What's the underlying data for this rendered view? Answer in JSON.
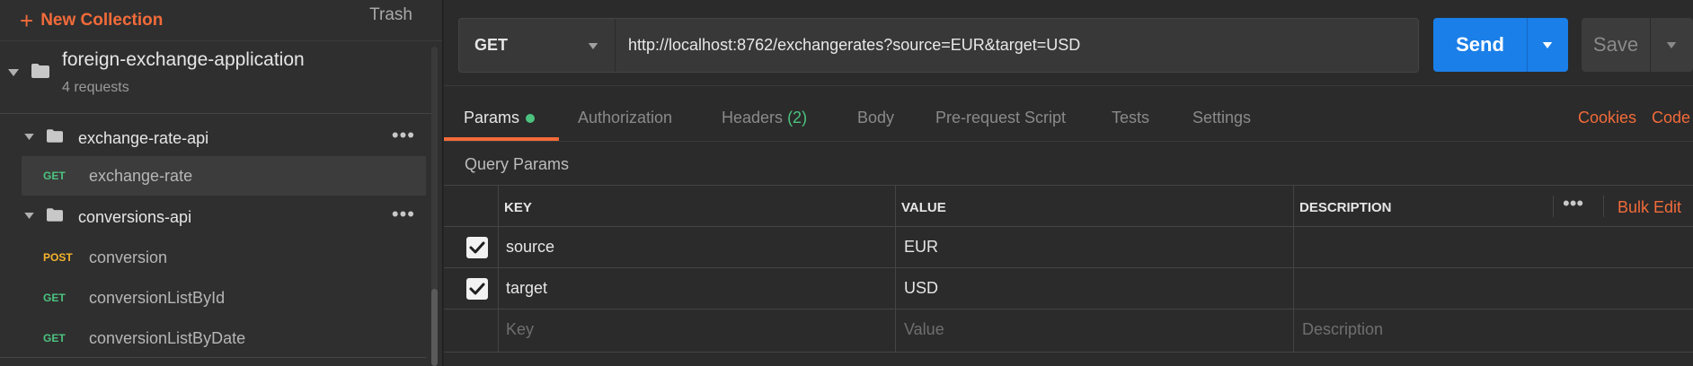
{
  "sidebar": {
    "new_collection": "New Collection",
    "trash": "Trash",
    "collection": {
      "name": "foreign-exchange-application",
      "sub": "4 requests"
    },
    "folders": [
      {
        "name": "exchange-rate-api",
        "requests": [
          {
            "method": "GET",
            "name": "exchange-rate"
          }
        ]
      },
      {
        "name": "conversions-api",
        "requests": [
          {
            "method": "POST",
            "name": "conversion"
          },
          {
            "method": "GET",
            "name": "conversionListById"
          },
          {
            "method": "GET",
            "name": "conversionListByDate"
          }
        ]
      }
    ]
  },
  "request": {
    "method": "GET",
    "url": "http://localhost:8762/exchangerates?source=EUR&target=USD",
    "send": "Send",
    "save": "Save"
  },
  "tabs": {
    "params": "Params",
    "authorization": "Authorization",
    "headers": "Headers",
    "headers_count": "(2)",
    "body": "Body",
    "prerequest": "Pre-request Script",
    "tests": "Tests",
    "settings": "Settings",
    "cookies": "Cookies",
    "code": "Code"
  },
  "params": {
    "title": "Query Params",
    "columns": {
      "key": "KEY",
      "value": "VALUE",
      "description": "DESCRIPTION"
    },
    "bulk_edit": "Bulk Edit",
    "rows": [
      {
        "key": "source",
        "value": "EUR",
        "checked": true
      },
      {
        "key": "target",
        "value": "USD",
        "checked": true
      }
    ],
    "placeholders": {
      "key": "Key",
      "value": "Value",
      "description": "Description"
    }
  },
  "colors": {
    "accent": "#f26b3a",
    "send": "#1a7fe8",
    "get": "#4cc37f",
    "post": "#f5b32d"
  }
}
